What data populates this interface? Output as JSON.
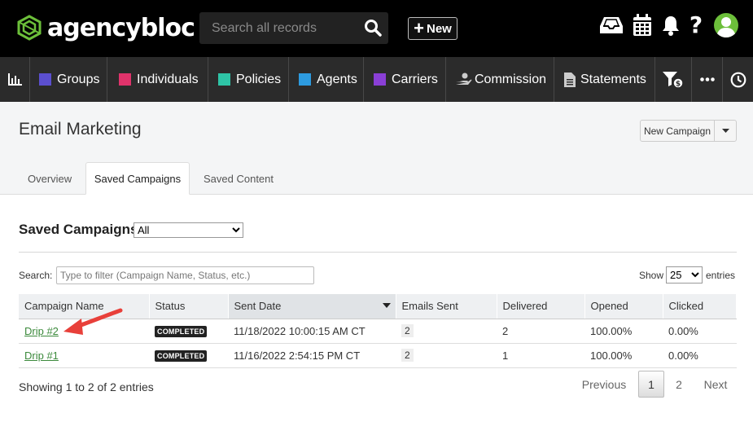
{
  "app": {
    "brand": "agencybloc",
    "search_placeholder": "Search all records",
    "new_label": "New",
    "icons": [
      "inbox-icon",
      "calendar-icon",
      "bell-icon",
      "help-icon",
      "avatar"
    ]
  },
  "nav": {
    "items": [
      {
        "label": "Groups",
        "color": "#5b4fcf"
      },
      {
        "label": "Individuals",
        "color": "#e0336b"
      },
      {
        "label": "Policies",
        "color": "#2ec4a6"
      },
      {
        "label": "Agents",
        "color": "#2d9be0"
      },
      {
        "label": "Carriers",
        "color": "#8a3fd6"
      },
      {
        "label": "Commission"
      },
      {
        "label": "Statements"
      }
    ]
  },
  "header": {
    "title": "Email Marketing",
    "new_campaign_label": "New Campaign"
  },
  "tabs": [
    {
      "label": "Overview",
      "active": false
    },
    {
      "label": "Saved Campaigns",
      "active": true
    },
    {
      "label": "Saved Content",
      "active": false
    }
  ],
  "section": {
    "title": "Saved Campaigns",
    "filter_value": "All",
    "search_label": "Search:",
    "search_placeholder": "Type to filter (Campaign Name, Status, etc.)",
    "show_label": "Show",
    "page_size": "25",
    "entries_label": "entries"
  },
  "table": {
    "columns": [
      "Campaign Name",
      "Status",
      "Sent Date",
      "Emails Sent",
      "Delivered",
      "Opened",
      "Clicked"
    ],
    "rows": [
      {
        "name": "Drip #2",
        "status": "COMPLETED",
        "sent_date": "11/18/2022 10:00:15 AM CT",
        "emails_sent": "2",
        "delivered": "2",
        "opened": "100.00%",
        "clicked": "0.00%"
      },
      {
        "name": "Drip #1",
        "status": "COMPLETED",
        "sent_date": "11/16/2022 2:54:15 PM CT",
        "emails_sent": "2",
        "delivered": "1",
        "opened": "100.00%",
        "clicked": "0.00%"
      }
    ]
  },
  "footer": {
    "info": "Showing 1 to 2 of 2 entries",
    "previous": "Previous",
    "pages": [
      "1",
      "2"
    ],
    "next": "Next"
  }
}
